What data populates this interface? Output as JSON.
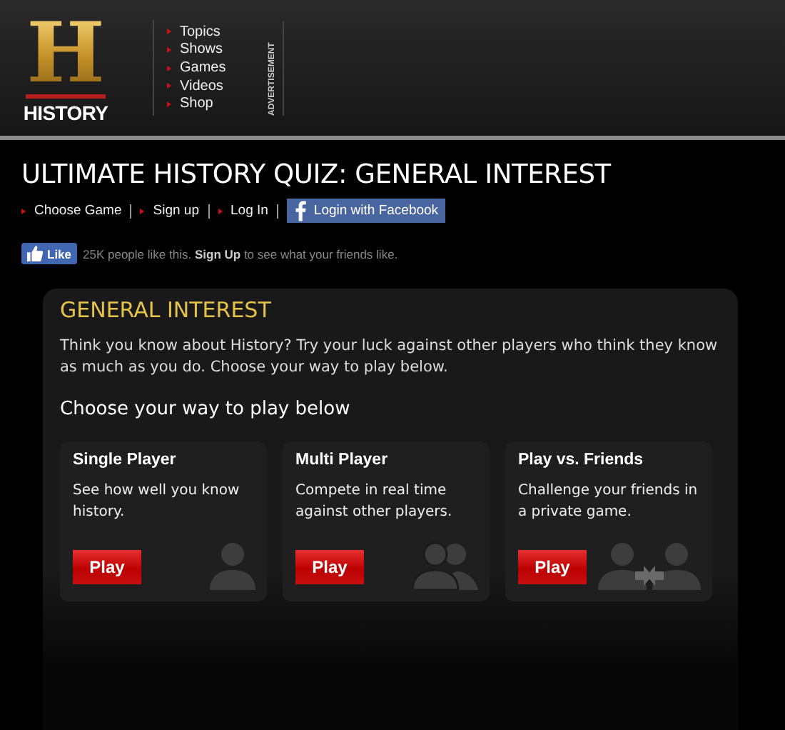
{
  "logo": {
    "letter": "H",
    "wordmark": "HISTORY"
  },
  "nav": [
    "Topics",
    "Shows",
    "Games",
    "Videos",
    "Shop"
  ],
  "ad_label": "ADVERTISEMENT",
  "page_title": "ULTIMATE HISTORY QUIZ: GENERAL INTEREST",
  "links": [
    "Choose Game",
    "Sign up",
    "Log In"
  ],
  "facebook_login": "Login with Facebook",
  "like": {
    "button": "Like",
    "text": "25K people like this. **Sign Up** to see what your friends like."
  },
  "panel": {
    "heading": "GENERAL INTEREST",
    "intro": "Think you know about History? Try your luck against other players who think they know as much as you do. Choose your way to play below.",
    "subheading": "Choose your way to play below",
    "cards": [
      {
        "kind": "single",
        "title": "Single Player",
        "text": "See how well you know history.",
        "button": "Play"
      },
      {
        "kind": "multi",
        "title": "Multi Player",
        "text": "Compete in real time against other players.",
        "button": "Play"
      },
      {
        "kind": "versus",
        "title": "Play vs. Friends",
        "text": "Challenge your friends in a private game.",
        "button": "Play"
      }
    ]
  }
}
